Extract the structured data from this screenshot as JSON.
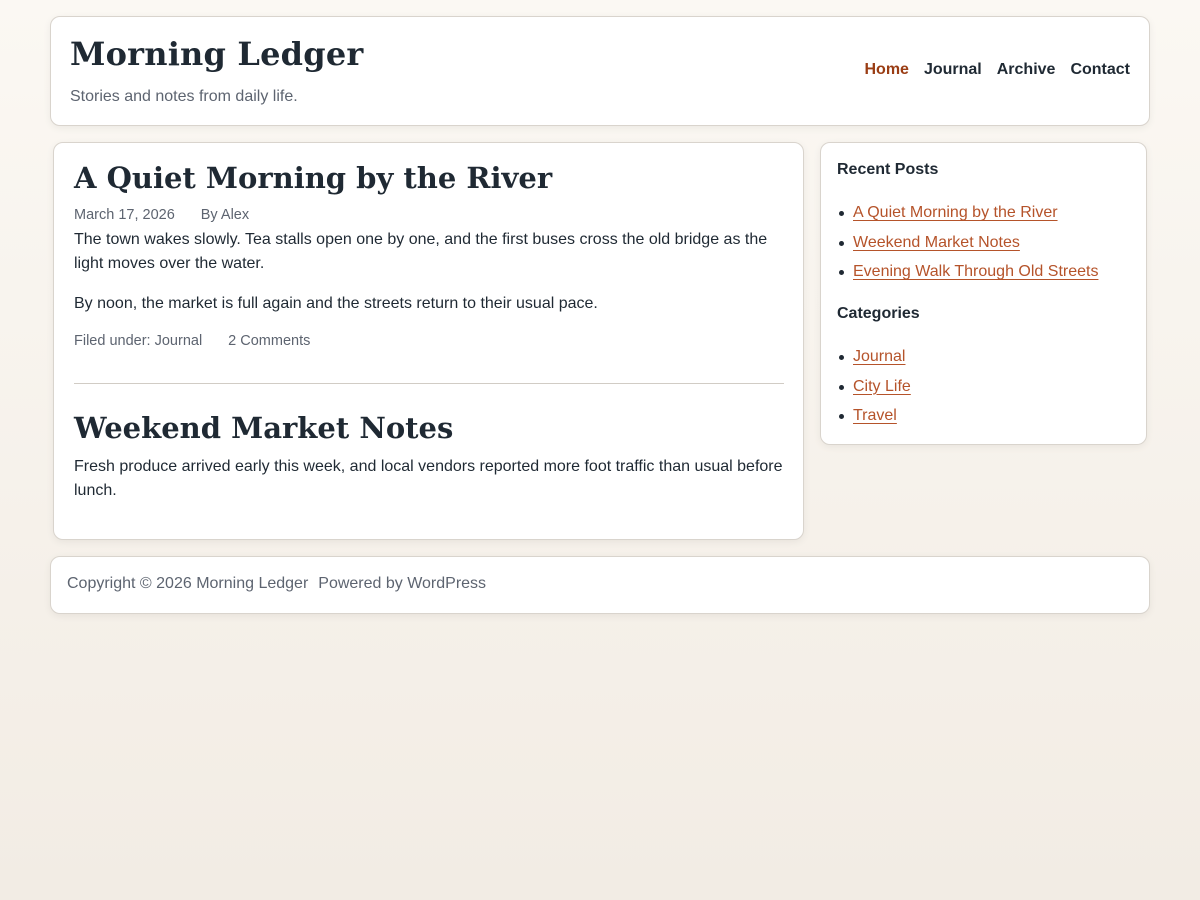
{
  "site": {
    "title": "Morning Ledger",
    "tagline": "Stories and notes from daily life."
  },
  "nav": {
    "items": [
      {
        "label": "Home",
        "active": true
      },
      {
        "label": "Journal",
        "active": false
      },
      {
        "label": "Archive",
        "active": false
      },
      {
        "label": "Contact",
        "active": false
      }
    ]
  },
  "posts": [
    {
      "title": "A Quiet Morning by the River",
      "date": "March 17, 2026",
      "author": "By Alex",
      "paragraphs": [
        "The town wakes slowly. Tea stalls open one by one, and the first buses cross the old bridge as the light moves over the water.",
        "By noon, the market is full again and the streets return to their usual pace."
      ],
      "filed_under_label": "Filed under:",
      "category": "Journal",
      "comments": "2 Comments"
    },
    {
      "title": "Weekend Market Notes",
      "paragraphs": [
        "Fresh produce arrived early this week, and local vendors reported more foot traffic than usual before lunch."
      ]
    }
  ],
  "sidebar": {
    "recent_posts": {
      "title": "Recent Posts",
      "items": [
        "A Quiet Morning by the River",
        "Weekend Market Notes",
        "Evening Walk Through Old Streets"
      ]
    },
    "categories": {
      "title": "Categories",
      "items": [
        "Journal",
        "City Life",
        "Travel"
      ]
    }
  },
  "footer": {
    "copyright": "Copyright © 2026 Morning Ledger",
    "powered_by": "Powered by WordPress"
  },
  "colors": {
    "accent": "#9a3d14",
    "link": "#b5532a",
    "text": "#1f2933",
    "muted": "#5d6470"
  }
}
